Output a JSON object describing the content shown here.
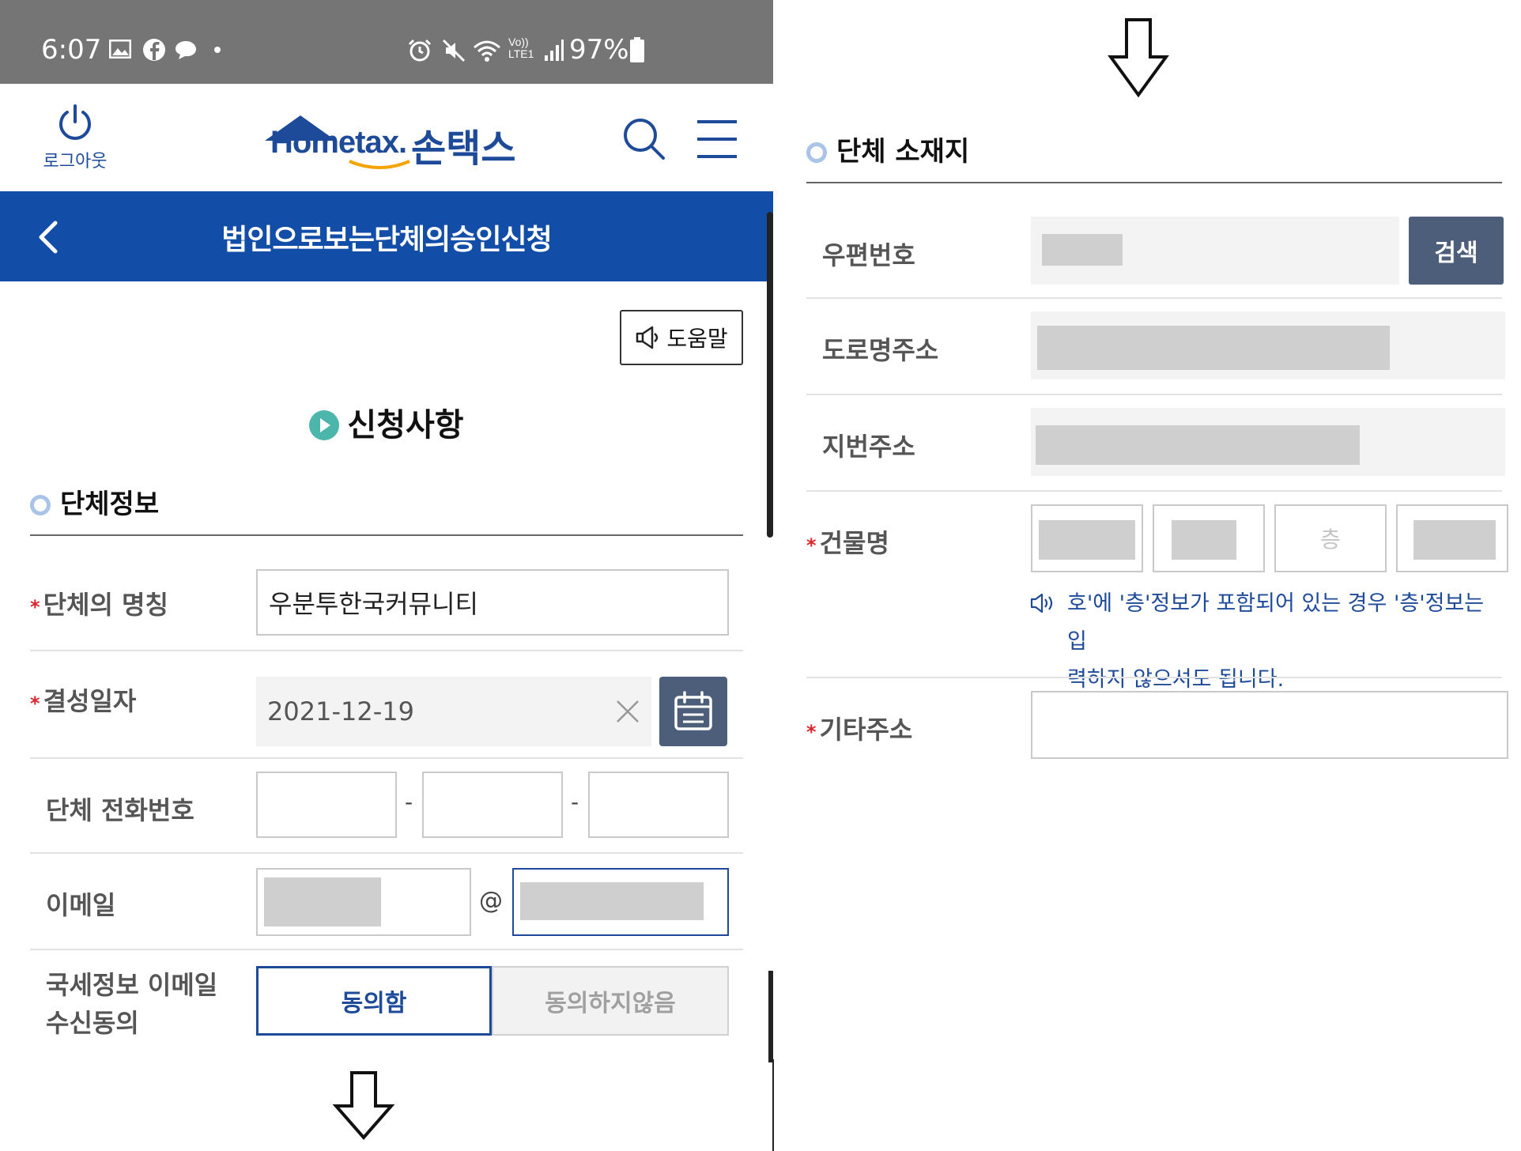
{
  "status_bar": {
    "time": "6:07",
    "battery": "97%",
    "left_icons": [
      "gallery-icon",
      "facebook-icon",
      "chat-bubble-icon",
      "dot-icon"
    ],
    "right_icons": [
      "alarm-icon",
      "mute-icon",
      "wifi-icon",
      "volte-icon",
      "signal-icon",
      "battery-icon"
    ]
  },
  "header": {
    "logout_label": "로그아웃",
    "logo_text": "Hometax.",
    "logo_kor": "손택스"
  },
  "title_bar": {
    "title": "법인으로보는단체의승인신청"
  },
  "help_button": {
    "label": "도움말"
  },
  "section": {
    "title": "신청사항"
  },
  "group_info": {
    "heading": "단체정보",
    "name_label": "단체의 명칭",
    "name_value": "우분투한국커뮤니티",
    "date_label": "결성일자",
    "date_value": "2021-12-19",
    "phone_label": "단체 전화번호",
    "phone_sep": "-",
    "email_label": "이메일",
    "email_at": "@",
    "consent_label_1": "국세정보 이메일",
    "consent_label_2": "수신동의",
    "consent_yes": "동의함",
    "consent_no": "동의하지않음"
  },
  "location": {
    "heading": "단체 소재지",
    "zip_label": "우편번호",
    "search_label": "검색",
    "road_label": "도로명주소",
    "lot_label": "지번주소",
    "building_label": "건물명",
    "floor_placeholder": "층",
    "note_line1": "호'에 '층'정보가 포함되어 있는 경우 '층'정보는 입",
    "note_line2": "력하지 않으셔도 됩니다.",
    "other_label": "기타주소"
  },
  "colors": {
    "brand_blue": "#124da8",
    "title_bar": "#124da8",
    "button_slate": "#4d5e7a",
    "required_red": "#d9262d",
    "status_bar": "#757575"
  }
}
